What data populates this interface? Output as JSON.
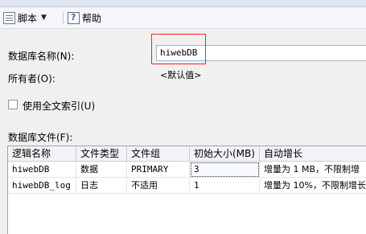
{
  "toolbar": {
    "script_label": "脚本",
    "help_label": "帮助"
  },
  "form": {
    "db_name_label": "数据库名称(N):",
    "db_name_value": "hiwebDB",
    "owner_label": "所有者(O):",
    "owner_value": "<默认值>",
    "fulltext_label": "使用全文索引(U)",
    "files_label": "数据库文件(F):"
  },
  "grid": {
    "headers": [
      "逻辑名称",
      "文件类型",
      "文件组",
      "初始大小(MB)",
      "自动增长"
    ],
    "rows": [
      [
        "hiwebDB",
        "数据",
        "PRIMARY",
        "3",
        "增量为 1 MB，不限制增"
      ],
      [
        "hiwebDB_log",
        "日志",
        "不适用",
        "1",
        "增量为 10%，不限制增长"
      ]
    ]
  }
}
